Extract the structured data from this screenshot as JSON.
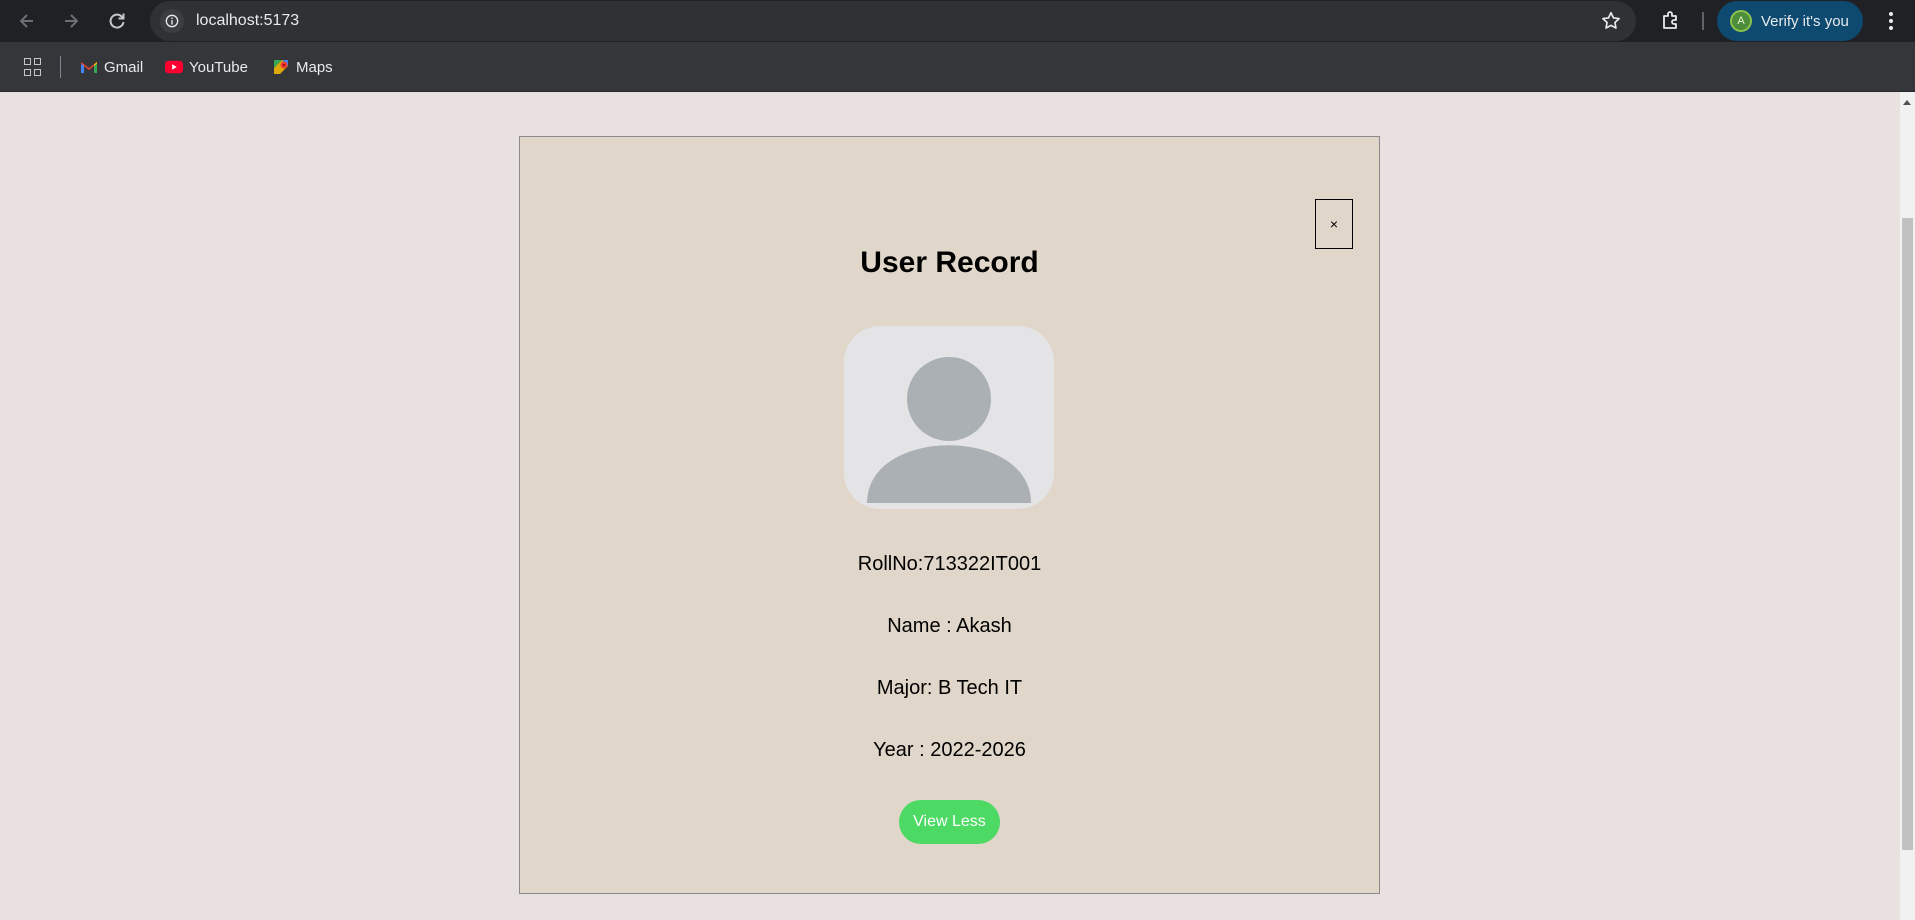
{
  "browser": {
    "url": "localhost:5173",
    "profile_button": "Verify it's you",
    "profile_initial": "A",
    "bookmarks": [
      {
        "label": "Gmail",
        "icon": "gmail-icon"
      },
      {
        "label": "YouTube",
        "icon": "youtube-icon"
      },
      {
        "label": "Maps",
        "icon": "maps-icon"
      }
    ]
  },
  "card": {
    "title": "User Record",
    "close_label": "×",
    "avatar_icon": "user-placeholder-icon",
    "rollno": "RollNo:713322IT001",
    "name": "Name : Akash",
    "major": "Major: B Tech IT",
    "year": "Year : 2022-2026",
    "toggle_label": "View Less"
  },
  "colors": {
    "page_bg": "#e9e1df",
    "card_bg": "#e0d6c9",
    "button_green": "#4cd964"
  }
}
